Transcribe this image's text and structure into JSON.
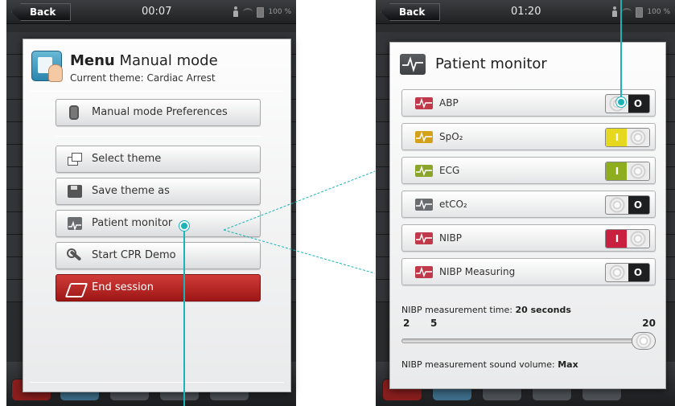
{
  "left_screen": {
    "back_label": "Back",
    "clock": "00:07",
    "battery": "100 %",
    "menu": {
      "title_bold": "Menu",
      "title_rest": "Manual mode",
      "subtitle": "Current theme: Cardiac Arrest",
      "items": [
        {
          "label": "Manual mode Preferences",
          "icon": "device-icon"
        },
        {
          "label": "Select theme",
          "icon": "theme-icon"
        },
        {
          "label": "Save theme as",
          "icon": "save-icon"
        },
        {
          "label": "Patient monitor",
          "icon": "waveform-icon"
        },
        {
          "label": "Start CPR Demo",
          "icon": "wrench-icon"
        },
        {
          "label": "End session",
          "icon": "end-session-icon"
        }
      ]
    }
  },
  "right_screen": {
    "back_label": "Back",
    "clock": "01:20",
    "battery": "100 %",
    "monitor": {
      "title": "Patient monitor",
      "rows": [
        {
          "label": "ABP",
          "state": "O",
          "on": false,
          "icon_color": "#c0394b",
          "on_color": ""
        },
        {
          "label": "SpO₂",
          "state": "I",
          "on": true,
          "icon_color": "#d4a21a",
          "on_color": "#e6d81e"
        },
        {
          "label": "ECG",
          "state": "I",
          "on": true,
          "icon_color": "#8aa52a",
          "on_color": "#8fae1f"
        },
        {
          "label": "etCO₂",
          "state": "O",
          "on": false,
          "icon_color": "#6a6d70",
          "on_color": ""
        },
        {
          "label": "NIBP",
          "state": "I",
          "on": true,
          "icon_color": "#c0394b",
          "on_color": "#c9203f"
        },
        {
          "label": "NIBP Measuring",
          "state": "O",
          "on": false,
          "icon_color": "#c0394b",
          "on_color": ""
        }
      ],
      "time_label": "NIBP measurement time:",
      "time_value": "20 seconds",
      "slider_min": "2",
      "slider_mid": "5",
      "slider_max": "20",
      "slider_fraction": 1.0,
      "volume_label": "NIBP measurement sound volume:",
      "volume_value": "Max"
    }
  },
  "colors": {
    "callout": "#1ab4b8",
    "danger": "#b32624"
  }
}
